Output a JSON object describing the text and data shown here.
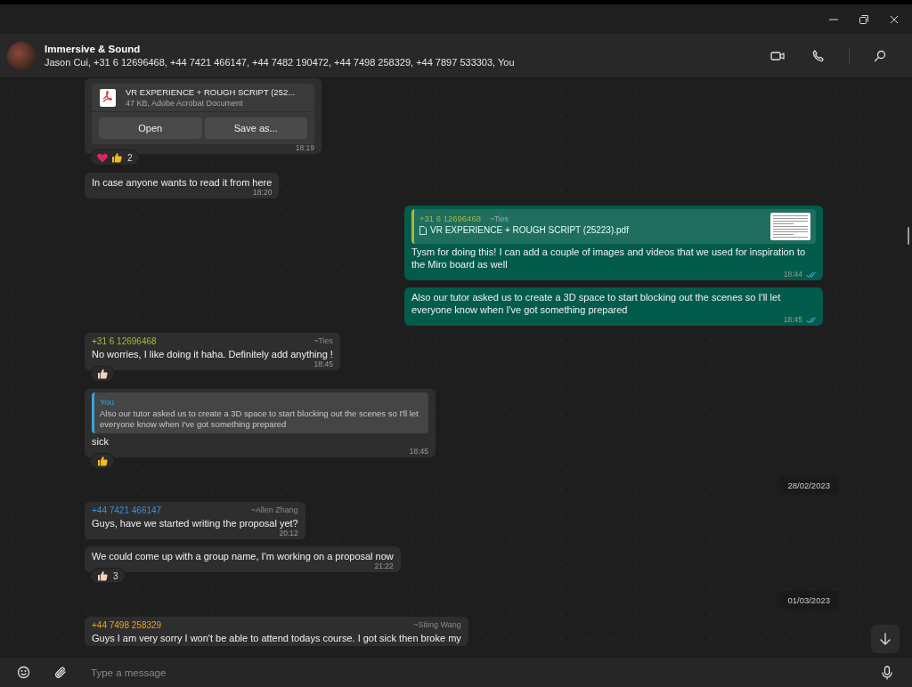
{
  "header": {
    "title": "Immersive & Sound",
    "participants": "Jason Cui, +31 6 12696468, +44 7421 466147, +44 7482 190472, +44 7498 258329, +44 7897 533303, You"
  },
  "messages": [
    {
      "kind": "file",
      "outgoing": false,
      "file_name": "VR EXPERIENCE + ROUGH SCRIPT (252...",
      "file_info": "47 KB, Adobe Acrobat Document",
      "buttons": [
        "Open",
        "Save as..."
      ],
      "time": "18:19",
      "reactions": [
        {
          "kind": "heart",
          "color": "#e0245e"
        },
        {
          "kind": "thumb",
          "color": "#f5b91e"
        }
      ],
      "reaction_count": "2"
    },
    {
      "kind": "text",
      "outgoing": false,
      "text": "In case anyone wants to read it from here",
      "time": "18:20"
    },
    {
      "kind": "text",
      "outgoing": true,
      "quote": {
        "author": "+31 6 12696468",
        "author_name": "~Ties",
        "text": "VR EXPERIENCE + ROUGH SCRIPT (25223).pdf",
        "color": "#a5b83a",
        "file": true
      },
      "text": "Tysm for doing this! I can add a couple of images and videos that we used for inspiration to the Miro board as well",
      "time": "18:44",
      "read": true
    },
    {
      "kind": "text",
      "outgoing": true,
      "text": "Also our tutor asked us to create a 3D space to start blocking out the scenes so I'll let everyone know when I've got something prepared",
      "time": "18:45",
      "read": true
    },
    {
      "kind": "text",
      "outgoing": false,
      "sender": {
        "number": "+31 6 12696468",
        "name": "~Ties",
        "color": "#a5b83a"
      },
      "text": "No worries, I like doing it haha. Definitely add anything !",
      "time": "18:45",
      "reactions": [
        {
          "kind": "thumb",
          "color": "#f3d3bd"
        }
      ]
    },
    {
      "kind": "text",
      "outgoing": false,
      "quote": {
        "author": "You",
        "text": "Also our tutor asked us to create a 3D space to start blocking out the scenes so I'll let everyone know when I've got something prepared",
        "color": "#35a4e0",
        "file": false
      },
      "text": "sick",
      "time": "18:45",
      "reactions": [
        {
          "kind": "thumb",
          "color": "#f5b91e"
        }
      ]
    },
    {
      "kind": "date",
      "text": "28/02/2023"
    },
    {
      "kind": "text",
      "outgoing": false,
      "sender": {
        "number": "+44 7421 466147",
        "name": "~Allen Zhang",
        "color": "#3a8ee0"
      },
      "text": "Guys, have we started writing the proposal yet?",
      "time": "20:12"
    },
    {
      "kind": "text",
      "outgoing": false,
      "text": "We could come up with a group name, I'm working on a proposal now",
      "time": "21:22",
      "reactions": [
        {
          "kind": "thumb",
          "color": "#f3d3bd"
        }
      ],
      "reaction_count": "3"
    },
    {
      "kind": "date",
      "text": "01/03/2023"
    },
    {
      "kind": "text",
      "outgoing": false,
      "sender": {
        "number": "+44 7498 258329",
        "name": "~Siting Wang",
        "color": "#e8a317"
      },
      "text": "Guys I am very sorry I won't be able to attend todays course. I got sick then broke my"
    }
  ],
  "composer": {
    "placeholder": "Type a message"
  }
}
